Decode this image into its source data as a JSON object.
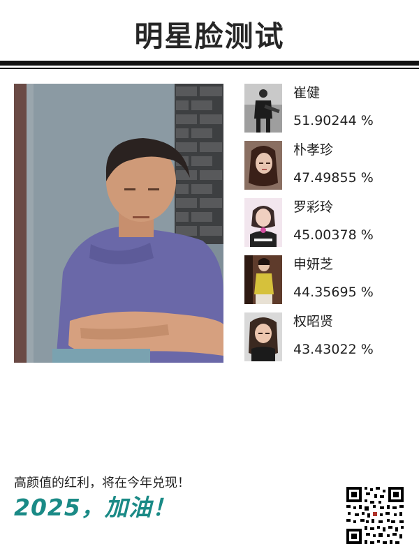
{
  "header": {
    "title": "明星脸测试"
  },
  "main": {
    "photo_alt": "user photo"
  },
  "matches": [
    {
      "name": "崔健",
      "score": "51.90244 %",
      "icon": "celebrity-photo"
    },
    {
      "name": "朴孝珍",
      "score": "47.49855 %",
      "icon": "celebrity-photo"
    },
    {
      "name": "罗彩玲",
      "score": "45.00378 %",
      "icon": "celebrity-photo"
    },
    {
      "name": "申妍芝",
      "score": "44.35695 %",
      "icon": "celebrity-photo"
    },
    {
      "name": "权昭贤",
      "score": "43.43022 %",
      "icon": "celebrity-photo"
    }
  ],
  "footer": {
    "text": "高颜值的红利，将在今年兑现！",
    "slogan": "2025，加油！",
    "qr": "qr-code"
  },
  "colors": {
    "accent": "#1a8a86",
    "rule": "#111111",
    "text": "#1f1f1f"
  }
}
